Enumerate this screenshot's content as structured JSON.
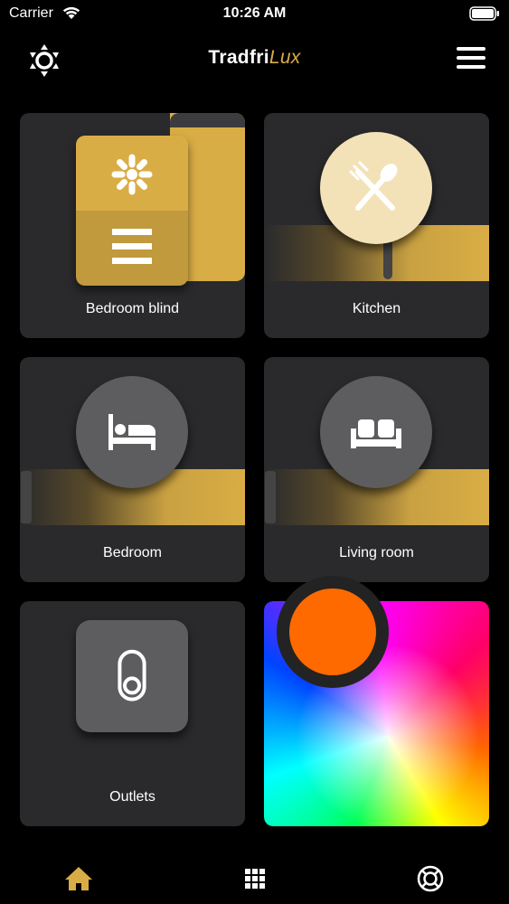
{
  "status_bar": {
    "carrier": "Carrier",
    "time": "10:26 AM"
  },
  "header": {
    "title_main": "Tradfri",
    "title_accent": "Lux",
    "left_icon": "brightness-icon",
    "right_icon": "menu-icon"
  },
  "tiles": [
    {
      "label": "Bedroom blind",
      "icon": "blind-icon"
    },
    {
      "label": "Kitchen",
      "icon": "fork-spoon-icon"
    },
    {
      "label": "Bedroom",
      "icon": "bed-icon"
    },
    {
      "label": "Living room",
      "icon": "sofa-icon"
    },
    {
      "label": "Outlets",
      "icon": "outlet-switch-icon"
    }
  ],
  "color_picker": {
    "selected_color": "#ff6a00"
  },
  "tab_bar": {
    "tabs": [
      {
        "icon": "home-icon",
        "active": true
      },
      {
        "icon": "grid-icon",
        "active": false
      },
      {
        "icon": "lifebuoy-icon",
        "active": false
      }
    ]
  },
  "colors": {
    "accent": "#d9ad45",
    "tile_bg": "#2a2a2c",
    "button_gray": "#5d5c5e"
  }
}
